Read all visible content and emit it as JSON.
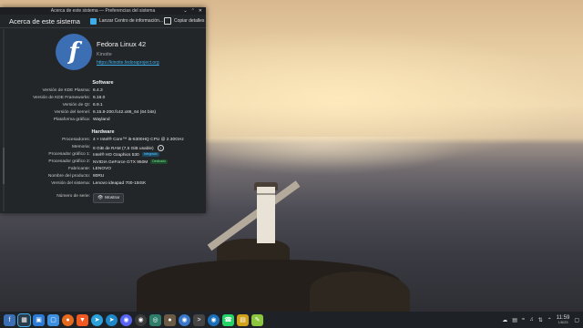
{
  "window": {
    "title": "Acerca de este sistema — Preferencias del sistema",
    "page_title": "Acerca de este sistema",
    "nav_label": "Lanzar Centro de información...",
    "details_label": "Copiar detalles"
  },
  "os": {
    "name": "Fedora Linux 42",
    "variant": "Kinoite",
    "url": "https://kinoite.fedoraproject.org"
  },
  "software": {
    "heading": "Software",
    "rows": [
      {
        "k": "Versión de KDE Plasma:",
        "v": "6.4.3"
      },
      {
        "k": "Versión de KDE Frameworks:",
        "v": "6.16.0"
      },
      {
        "k": "Versión de Qt:",
        "v": "6.9.1"
      },
      {
        "k": "Versión del kernel:",
        "v": "6.15.8-200.fc42.x86_64 (64 bits)"
      },
      {
        "k": "Plataforma gráfica:",
        "v": "Wayland"
      }
    ]
  },
  "hardware": {
    "heading": "Hardware",
    "rows": [
      {
        "k": "Procesadores:",
        "v": "4 × Intel® Core™ i5-6300HQ CPU @ 2.30GHz"
      },
      {
        "k": "Memoria:",
        "v": "8 GiB de RAM (7,5 GiB usable)"
      },
      {
        "k": "Procesador gráfico 1:",
        "v": "Intel® HD Graphics 530",
        "badge": "Integrado"
      },
      {
        "k": "Procesador gráfico 2:",
        "v": "NVIDIA GeForce GTX 950M",
        "badge": "Dedicado"
      },
      {
        "k": "Fabricante:",
        "v": "LENOVO"
      },
      {
        "k": "Nombre del producto:",
        "v": "80RU"
      },
      {
        "k": "Versión del sistema:",
        "v": "Lenovo ideapad 700-15ISK"
      },
      {
        "k": "Número de serie:",
        "v": ""
      }
    ],
    "show_button": "Mostrar"
  },
  "taskbar": {
    "apps": [
      "launcher",
      "overview",
      "dolphin",
      "files",
      "firefox",
      "brave",
      "telegram",
      "telegram-desktop",
      "discord",
      "obs",
      "chromium",
      "gimp",
      "vlc",
      "terminal",
      "steam",
      "whatsapp",
      "libreoffice",
      "kate"
    ],
    "time": "11:59",
    "date": "1/8/25"
  },
  "colors": {
    "accent": "#3daee9",
    "fedora_blue": "#3c6eb4",
    "window_bg": "#232629",
    "taskbar_bg": "#1e2125"
  }
}
